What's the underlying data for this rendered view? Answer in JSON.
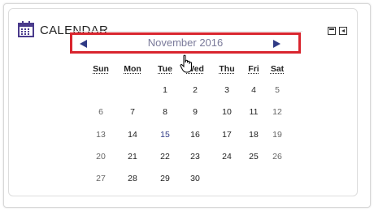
{
  "block": {
    "title": "CALENDAR",
    "icons": [
      "calendar-icon",
      "minimize-icon",
      "dock-icon"
    ]
  },
  "nav": {
    "month_label": "November 2016",
    "prev_icon": "left-triangle-arrow",
    "next_icon": "right-triangle-arrow"
  },
  "weekdays": [
    "Sun",
    "Mon",
    "Tue",
    "Wed",
    "Thu",
    "Fri",
    "Sat"
  ],
  "weeks": [
    [
      "",
      "",
      "1",
      "2",
      "3",
      "4",
      "5"
    ],
    [
      "6",
      "7",
      "8",
      "9",
      "10",
      "11",
      "12"
    ],
    [
      "13",
      "14",
      "15",
      "16",
      "17",
      "18",
      "19"
    ],
    [
      "20",
      "21",
      "22",
      "23",
      "24",
      "25",
      "26"
    ],
    [
      "27",
      "28",
      "29",
      "30",
      "",
      "",
      ""
    ]
  ],
  "colors": {
    "highlight_border": "#d9252e",
    "arrow": "#2f3a85",
    "calendar_icon": "#4a3b8c"
  }
}
